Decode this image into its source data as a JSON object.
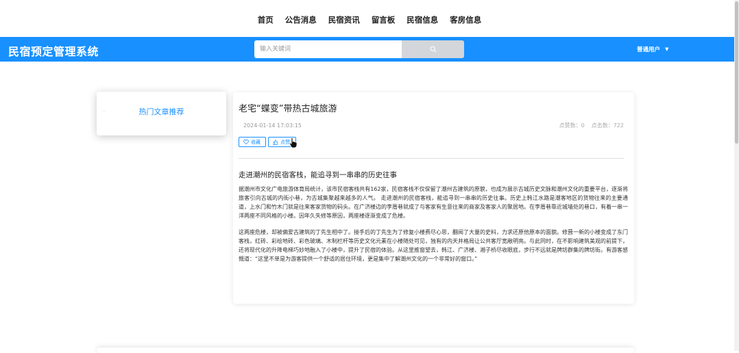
{
  "nav": {
    "items": [
      "首页",
      "公告消息",
      "民宿资讯",
      "留言板",
      "民宿信息",
      "客房信息"
    ]
  },
  "header": {
    "brand": "民宿预定管理系统",
    "search_placeholder": "输入关键词",
    "search_icon": "search-icon",
    "user_label": "普通用户",
    "accent_color": "#1890ff"
  },
  "sidebar": {
    "title": "热门文章推荐"
  },
  "article": {
    "title": "老宅“蝶变”带热古城旅游",
    "date": "2024-01-14 17:03:15",
    "likes_label": "点赞数：0",
    "clicks_label": "点击数：722",
    "favorite_label": "收藏",
    "like_label": "点赞",
    "subtitle": "走进潮州的民宿客栈，能追寻到一串串的历史往事",
    "paragraph1": "据潮州市文化广电旅游体育局统计，该市民宿客栈共有162家，民宿客栈不仅保留了潮州古建筑的原貌，也成为展示古城历史文脉和潮州文化的重要平台，逐渐将旅客引向古城的内街小巷，为古城集聚越来越多的人气。 走进潮州的民宿客栈，能追寻到一串串的历史往事。历史上韩江水路是潮客地区的货物往来的主要通道，上水门和竹木门就是往来客家货物的码头。在广济楼边的李厝巷就成了与客家有生意往来的商家及客家人的聚居地。在李厝巷靠近城墙处的巷口，有着一串一洋两座不同风格的小楼。因年久失修等原因，两座楼逐渐变成了危楼。",
    "paragraph2": "这两座危楼，却被偏爱古建筑的丁先生相中了。接手后的丁先生为了修复小楼费尽心思，翻阅了大量的史料，力求还原他原本的面貌。修葺一新的小楼变成了东门客栈，红砖、彩绘地砖、彩色玻璃、木制栏杆等历史文化元素在小楼随处可见，独有的内天井格局让公共客厅宽敞明亮。与此同时，在不影响建筑美观的前提下，还将现代化的升降电梯巧妙地融入了小楼中，提升了民宿的体验。从这里推窗望去，韩江、广济楼、湘子桥尽收眼底，步行不远就是牌坊群集的牌坊街。有游客感慨道：“这里不单是为游客提供一个舒适的居住环境，更是集中了解潮州文化的一个非常好的窗口。”"
  }
}
